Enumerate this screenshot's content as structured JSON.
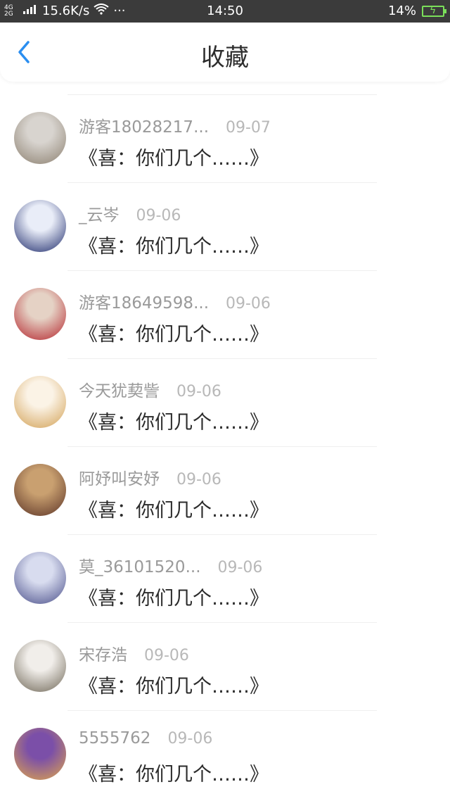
{
  "status": {
    "network": "4G 2G",
    "speed": "15.6K/s",
    "more": "···",
    "time": "14:50",
    "battery": "14%"
  },
  "header": {
    "title": "收藏"
  },
  "items": [
    {
      "name": "游客18028217...",
      "date": "09-07",
      "title": "《喜：你们几个……》",
      "avatar_colors": [
        "#d8d4cf",
        "#8c8070"
      ]
    },
    {
      "name": "_云岑",
      "date": "09-06",
      "title": "《喜：你们几个……》",
      "avatar_colors": [
        "#e9edf8",
        "#1d2a6b"
      ]
    },
    {
      "name": "游客18649598...",
      "date": "09-06",
      "title": "《喜：你们几个……》",
      "avatar_colors": [
        "#e5d2c5",
        "#b4242c"
      ]
    },
    {
      "name": "今天犹葜訾",
      "date": "09-06",
      "title": "《喜：你们几个……》",
      "avatar_colors": [
        "#fbf3e6",
        "#d2a054"
      ]
    },
    {
      "name": "阿妤叫安妤",
      "date": "09-06",
      "title": "《喜：你们几个……》",
      "avatar_colors": [
        "#c9a070",
        "#5b3326"
      ]
    },
    {
      "name": "莫_36101520...",
      "date": "09-06",
      "title": "《喜：你们几个……》",
      "avatar_colors": [
        "#d8dcef",
        "#4a4f8a"
      ]
    },
    {
      "name": "宋存浩",
      "date": "09-06",
      "title": "《喜：你们几个……》",
      "avatar_colors": [
        "#f1eeea",
        "#6e6656"
      ]
    },
    {
      "name": "5555762",
      "date": "09-06",
      "title": "《喜：你们几个……》",
      "avatar_colors": [
        "#7b4fa8",
        "#e0a64a"
      ]
    }
  ]
}
